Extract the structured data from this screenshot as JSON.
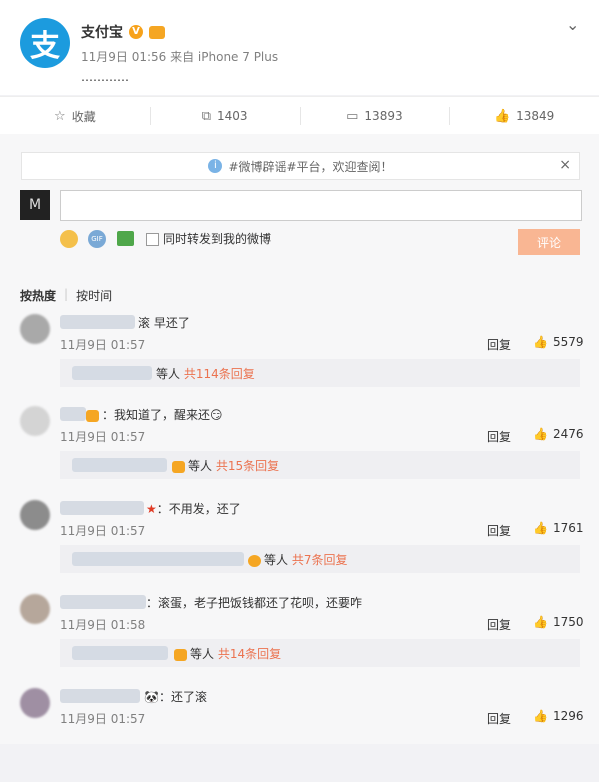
{
  "post": {
    "author": "支付宝",
    "verified_badge": "V",
    "meta": "11月9日 01:56 来自 iPhone 7 Plus",
    "text": "…………",
    "logo_char": "支"
  },
  "actions": [
    {
      "icon": "star-icon",
      "glyph": "☆",
      "label": "收藏"
    },
    {
      "icon": "repost-icon",
      "glyph": "⧉",
      "label": "1403"
    },
    {
      "icon": "comment-icon",
      "glyph": "▭",
      "label": "13893"
    },
    {
      "icon": "like-icon",
      "glyph": "👍",
      "label": "13849"
    }
  ],
  "notice": {
    "text": "#微博辟谣#平台，欢迎查阅！",
    "close": "×",
    "info": "i"
  },
  "composer": {
    "avatar_char": "M",
    "input_value": "",
    "gif": "GIF",
    "checkbox_label": "同时转发到我的微博",
    "submit": "评论"
  },
  "sort": {
    "hot": "按热度",
    "time": "按时间"
  },
  "comments": [
    {
      "text": "滚  早还了",
      "time": "11月9日 01:57",
      "reply": "回复",
      "likes": "5579",
      "sub_prefix": "等人",
      "sub_count": "共114条回复"
    },
    {
      "text": "：我知道了，醒来还😏",
      "time": "11月9日 01:57",
      "reply": "回复",
      "likes": "2476",
      "sub_prefix": "等人",
      "sub_count": "共15条回复"
    },
    {
      "text": "：不用发，还了",
      "time": "11月9日 01:57",
      "reply": "回复",
      "likes": "1761",
      "sub_prefix": "等人",
      "sub_count": "共7条回复"
    },
    {
      "text": "：滚蛋，老子把饭钱都还了花呗，还要咋",
      "time": "11月9日 01:58",
      "reply": "回复",
      "likes": "1750",
      "sub_prefix": "等人",
      "sub_count": "共14条回复"
    },
    {
      "text": "：还了滚",
      "time": "11月9日 01:57",
      "reply": "回复",
      "likes": "1296"
    }
  ],
  "colors": {
    "accent": "#eb7350",
    "brand": "#1c9bde",
    "submit_bg": "#f9b693"
  }
}
